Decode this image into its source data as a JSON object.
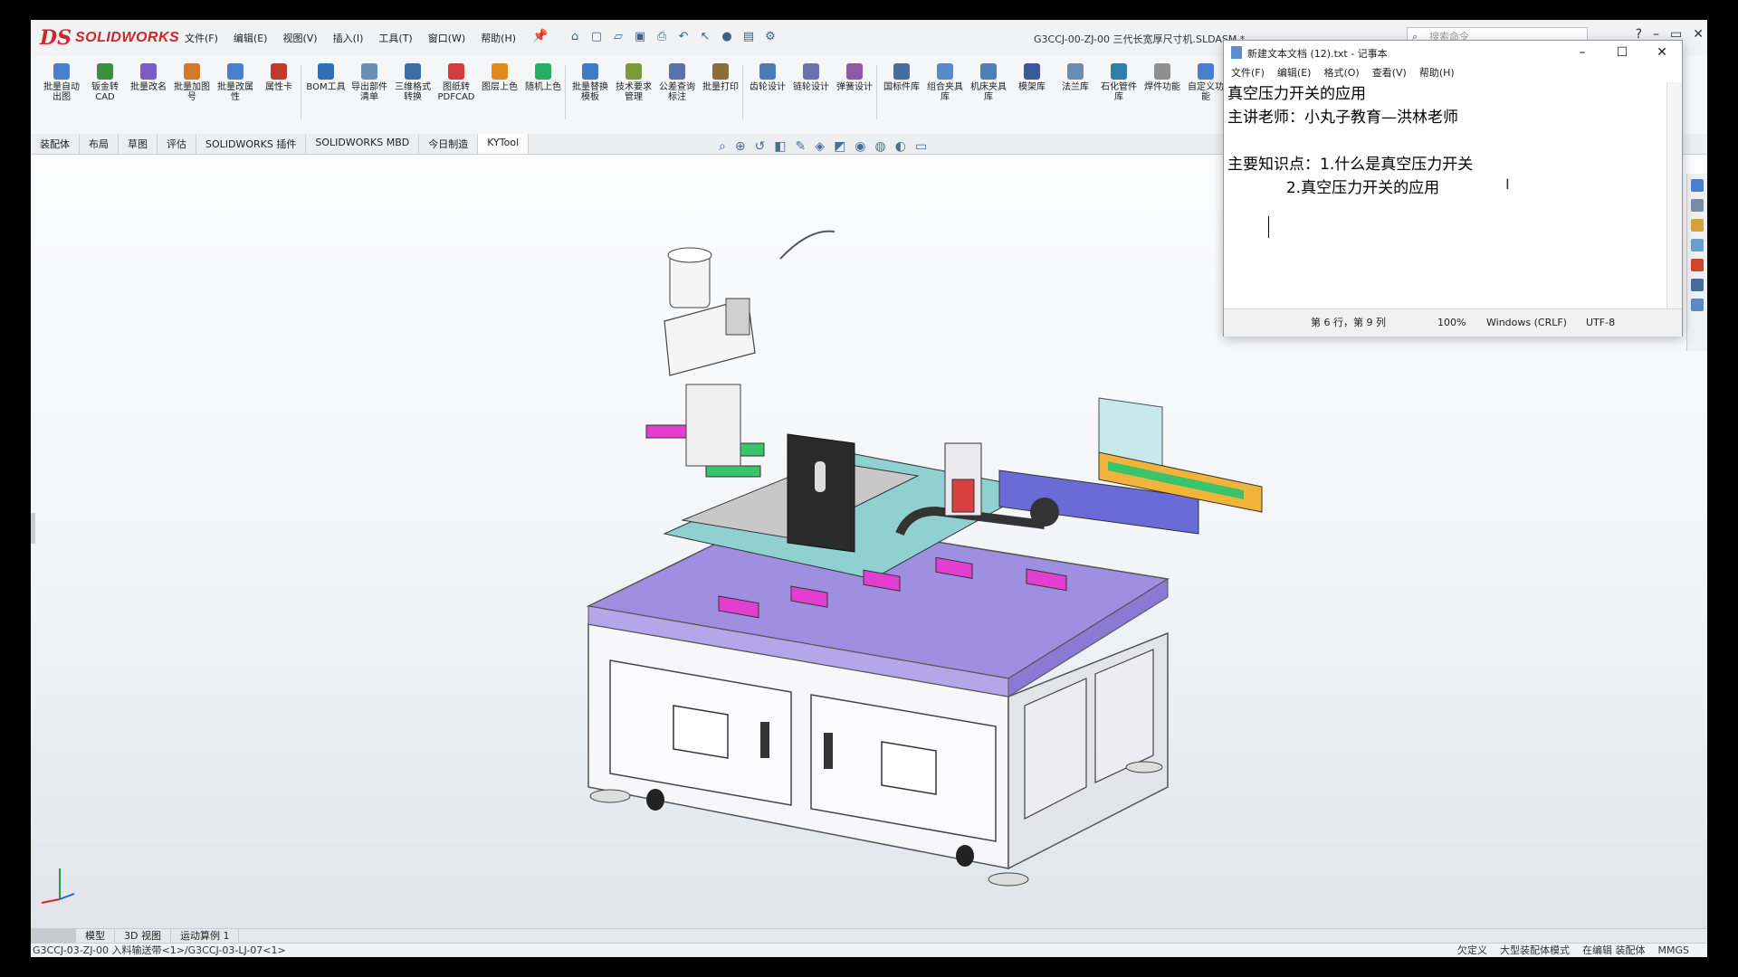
{
  "app": {
    "logo_text": "SOLIDWORKS",
    "logo_mark": "DS",
    "menu": [
      "文件(F)",
      "编辑(E)",
      "视图(V)",
      "插入(I)",
      "工具(T)",
      "窗口(W)",
      "帮助(H)"
    ],
    "document_title": "G3CCJ-00-ZJ-00 三代长宽厚尺寸机.SLDASM *",
    "search_placeholder": "搜索命令"
  },
  "ribbon": {
    "items": [
      "批量自动出图",
      "钣金转CAD",
      "批量改名",
      "批量加图号",
      "批量改属性",
      "属性卡",
      "BOM工具",
      "导出部件清单",
      "三维格式转换",
      "图纸转PDFCAD",
      "图层上色",
      "随机上色",
      "批量替换模板",
      "技术要求管理",
      "公差查询标注",
      "批量打印",
      "齿轮设计",
      "链轮设计",
      "弹簧设计",
      "国标件库",
      "组合夹具库",
      "机床夹具库",
      "模架库",
      "法兰库",
      "石化管件库",
      "焊件功能",
      "自定义功能"
    ],
    "colors": [
      "#4a7fd0",
      "#3e8e41",
      "#7b5cc4",
      "#d07a2a",
      "#4a7fd0",
      "#c0392b",
      "#2f6fb8",
      "#6a8fb7",
      "#3e6ea8",
      "#d33d3d",
      "#e08a1e",
      "#27ae60",
      "#3e7bc4",
      "#7d9a3a",
      "#5b72a8",
      "#8a6d3b",
      "#4b7ab8",
      "#6f6fb0",
      "#8e5aa8",
      "#4a6c9a",
      "#5a8ac6",
      "#4f7fb2",
      "#3b5998",
      "#6b8bb5",
      "#2f7fa6",
      "#8f8f8f",
      "#4a7fd0"
    ]
  },
  "command_tabs": [
    "装配体",
    "布局",
    "草图",
    "评估",
    "SOLIDWORKS 插件",
    "SOLIDWORKS MBD",
    "今日制造",
    "KYTool"
  ],
  "model_tabs": [
    "模型",
    "3D 视图",
    "运动算例 1"
  ],
  "status_bar": {
    "path": "G3CCJ-03-ZJ-00 入料输送带<1>/G3CCJ-03-LJ-07<1>",
    "right": [
      "欠定义",
      "大型装配体模式",
      "在编辑 装配体",
      "MMGS"
    ]
  },
  "notepad": {
    "title": "新建文本文档 (12).txt - 记事本",
    "menu": [
      "文件(F)",
      "编辑(E)",
      "格式(O)",
      "查看(V)",
      "帮助(H)"
    ],
    "lines": [
      "真空压力开关的应用",
      "主讲老师：小丸子教育—洪林老师",
      "",
      "主要知识点：1.什么是真空压力开关",
      "            2.真空压力开关的应用",
      ""
    ],
    "status": {
      "position": "第 6 行，第 9 列",
      "zoom": "100%",
      "line_ending": "Windows (CRLF)",
      "encoding": "UTF-8"
    }
  },
  "colors": {
    "brand_red": "#d0262b",
    "machine_frame": "#9e8fe0",
    "magenta_parts": "#e23fd0",
    "conveyor_orange": "#f2b33a"
  }
}
